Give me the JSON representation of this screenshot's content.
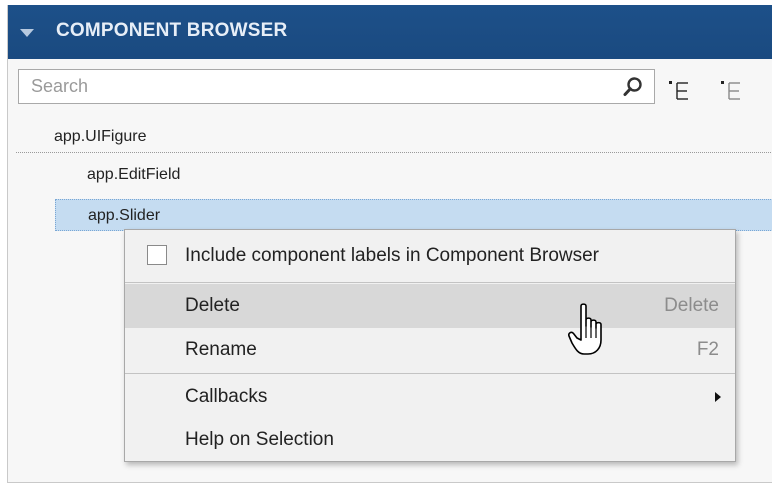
{
  "header": {
    "title": "COMPONENT BROWSER"
  },
  "search": {
    "placeholder": "Search",
    "value": ""
  },
  "tree": {
    "root": "app.UIFigure",
    "children": [
      "app.EditField",
      "app.Slider"
    ]
  },
  "context_menu": {
    "include_labels": {
      "label": "Include component labels in Component Browser",
      "checked": false
    },
    "items": [
      {
        "label": "Delete",
        "shortcut": "Delete"
      },
      {
        "label": "Rename",
        "shortcut": "F2"
      },
      {
        "label": "Callbacks",
        "shortcut": ""
      },
      {
        "label": "Help on Selection",
        "shortcut": ""
      }
    ]
  },
  "colors": {
    "header_bg": "#1d5089",
    "selection_bg": "#c5dcf1",
    "menu_hover_bg": "#d8d8d8"
  },
  "icons": [
    "chevron-down-icon",
    "search-icon",
    "expand-all-icon",
    "collapse-all-icon",
    "hand-pointer-cursor-icon",
    "submenu-arrow-icon"
  ]
}
